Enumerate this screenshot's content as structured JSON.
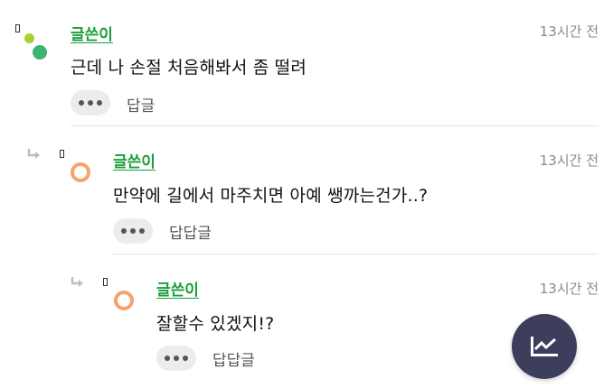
{
  "colors": {
    "author": "#1a9e3a",
    "fab_background": "#3d3d5c",
    "avatar_green": "#3cb371",
    "avatar_lime": "#a4d233",
    "avatar_orange": "#f4a46a"
  },
  "comments": [
    {
      "author": "글쓴이",
      "time": "13시간 전",
      "text": "근데 나 손절 처음해봐서 좀 떨려",
      "reply_label": "답글",
      "avatar_icon": "two-dot-avatar-icon"
    },
    {
      "author": "글쓴이",
      "time": "13시간 전",
      "text": "만약에 길에서 마주치면 아예 쌩까는건가..?",
      "reply_label": "답답글",
      "avatar_icon": "orange-ring-avatar-icon"
    },
    {
      "author": "글쓴이",
      "time": "13시간 전",
      "text": "잘할수 있겠지!?",
      "reply_label": "답답글",
      "avatar_icon": "orange-ring-avatar-icon"
    }
  ],
  "fab": {
    "icon": "trending-chart-icon"
  }
}
